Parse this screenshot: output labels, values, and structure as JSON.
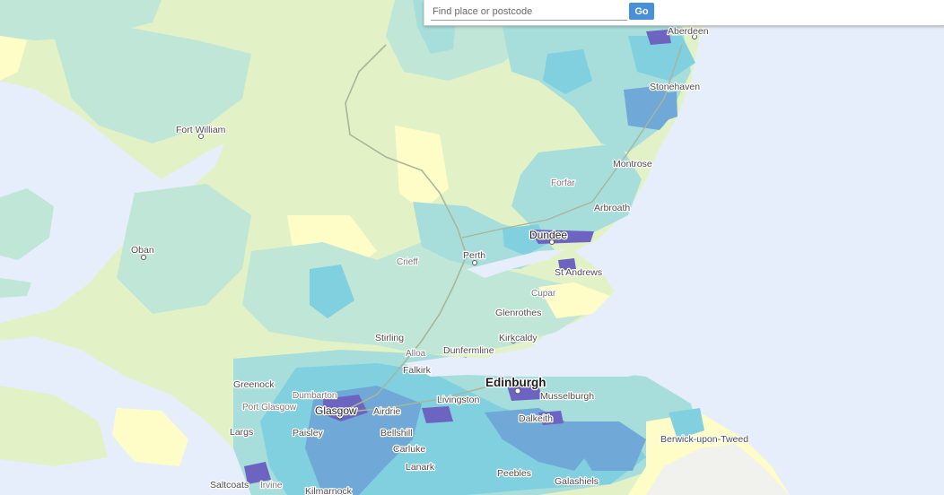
{
  "search": {
    "placeholder": "Find place or postcode",
    "value": "",
    "go_label": "Go"
  },
  "map": {
    "colors": {
      "sea": "#e6eefb",
      "land_low": "#fefdc8",
      "land_mid": "#e2f2c6",
      "band_teal": "#bfe6d6",
      "band_aqua": "#a7dedb",
      "band_cyan": "#80d0e0",
      "band_blue": "#70a8d8",
      "band_purple": "#6c64c0"
    },
    "places": [
      {
        "id": "aberdeen",
        "name": "Aberdeen",
        "tier": "town"
      },
      {
        "id": "stonehaven",
        "name": "Stonehaven",
        "tier": "town"
      },
      {
        "id": "fort-william",
        "name": "Fort William",
        "tier": "town"
      },
      {
        "id": "montrose",
        "name": "Montrose",
        "tier": "town"
      },
      {
        "id": "forfar",
        "name": "Forfar",
        "tier": "minor"
      },
      {
        "id": "arbroath",
        "name": "Arbroath",
        "tier": "town"
      },
      {
        "id": "dundee",
        "name": "Dundee",
        "tier": "major"
      },
      {
        "id": "oban",
        "name": "Oban",
        "tier": "town"
      },
      {
        "id": "perth",
        "name": "Perth",
        "tier": "town"
      },
      {
        "id": "crieff",
        "name": "Crieff",
        "tier": "minor"
      },
      {
        "id": "st-andrews",
        "name": "St Andrews",
        "tier": "town"
      },
      {
        "id": "cupar",
        "name": "Cupar",
        "tier": "minor"
      },
      {
        "id": "glenrothes",
        "name": "Glenrothes",
        "tier": "town"
      },
      {
        "id": "stirling",
        "name": "Stirling",
        "tier": "town"
      },
      {
        "id": "alloa",
        "name": "Alloa",
        "tier": "minor"
      },
      {
        "id": "kirkcaldy",
        "name": "Kirkcaldy",
        "tier": "town"
      },
      {
        "id": "dunfermline",
        "name": "Dunfermline",
        "tier": "town"
      },
      {
        "id": "falkirk",
        "name": "Falkirk",
        "tier": "town"
      },
      {
        "id": "greenock",
        "name": "Greenock",
        "tier": "town"
      },
      {
        "id": "dumbarton",
        "name": "Dumbarton",
        "tier": "minor"
      },
      {
        "id": "edinburgh",
        "name": "Edinburgh",
        "tier": "capital"
      },
      {
        "id": "musselburgh",
        "name": "Musselburgh",
        "tier": "town"
      },
      {
        "id": "livingston",
        "name": "Livingston",
        "tier": "town"
      },
      {
        "id": "port-glasgow",
        "name": "Port Glasgow",
        "tier": "minor"
      },
      {
        "id": "glasgow",
        "name": "Glasgow",
        "tier": "major"
      },
      {
        "id": "airdrie",
        "name": "Airdrie",
        "tier": "town"
      },
      {
        "id": "dalkeith",
        "name": "Dalkeith",
        "tier": "town"
      },
      {
        "id": "largs",
        "name": "Largs",
        "tier": "town"
      },
      {
        "id": "paisley",
        "name": "Paisley",
        "tier": "town"
      },
      {
        "id": "bellshill",
        "name": "Bellshill",
        "tier": "town"
      },
      {
        "id": "berwick",
        "name": "Berwick-upon-Tweed",
        "tier": "town"
      },
      {
        "id": "carluke",
        "name": "Carluke",
        "tier": "town"
      },
      {
        "id": "lanark",
        "name": "Lanark",
        "tier": "town"
      },
      {
        "id": "peebles",
        "name": "Peebles",
        "tier": "town"
      },
      {
        "id": "galashiels",
        "name": "Galashiels",
        "tier": "town"
      },
      {
        "id": "saltcoats",
        "name": "Saltcoats",
        "tier": "town"
      },
      {
        "id": "irvine",
        "name": "Irvine",
        "tier": "minor"
      },
      {
        "id": "kilmarnock",
        "name": "Kilmarnock",
        "tier": "town"
      }
    ]
  }
}
